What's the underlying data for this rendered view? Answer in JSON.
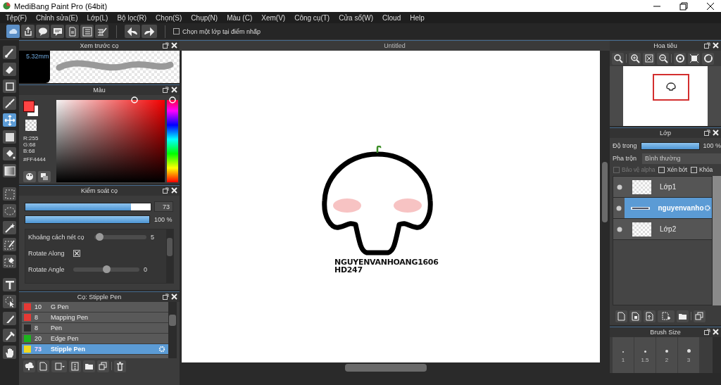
{
  "window": {
    "title": "MediBang Paint Pro (64bit)"
  },
  "menu": [
    "Tệp(F)",
    "Chỉnh sửa(E)",
    "Lớp(L)",
    "Bộ lọc(R)",
    "Chọn(S)",
    "Chụp(N)",
    "Màu (C)",
    "Xem(V)",
    "Công cụ(T)",
    "Cửa sổ(W)",
    "Cloud",
    "Help"
  ],
  "toolbar": {
    "option": {
      "label": "Chọn một lớp tại điểm nhấp",
      "checked": false
    }
  },
  "tools": [
    {
      "kind": "brush",
      "selected": false
    },
    {
      "kind": "eraser",
      "selected": false
    },
    {
      "kind": "dot",
      "selected": false
    },
    {
      "kind": "curve",
      "selected": false
    },
    {
      "kind": "move",
      "selected": true
    },
    {
      "kind": "fill",
      "selected": false
    },
    {
      "kind": "bucket",
      "selected": false
    },
    {
      "kind": "gradient",
      "selected": false
    },
    {
      "kind": "select",
      "selected": false
    },
    {
      "kind": "lasso",
      "selected": false
    },
    {
      "kind": "wand",
      "selected": false
    },
    {
      "kind": "selpen",
      "selected": false
    },
    {
      "kind": "selerase",
      "selected": false
    },
    {
      "kind": "text",
      "selected": false
    },
    {
      "kind": "operation",
      "selected": false
    },
    {
      "kind": "divide",
      "selected": false
    },
    {
      "kind": "dropper",
      "selected": false
    },
    {
      "kind": "hand",
      "selected": false
    }
  ],
  "brush_preview": {
    "title": "Xem trước cọ",
    "size": "5.32mm"
  },
  "color": {
    "title": "Màu",
    "r": "R:255",
    "g": "G:68",
    "b": "B:68",
    "hex": "#FF4444"
  },
  "brush_control": {
    "title": "Kiểm soát cọ",
    "size": {
      "level": 0.84,
      "reading": "73"
    },
    "opacity": {
      "level": 1,
      "reading": "100 %"
    },
    "rows": [
      {
        "kind": "slider",
        "label": "Khoảng cách nét cọ",
        "level": 0.03,
        "reading": "5"
      },
      {
        "kind": "checkbox",
        "label": "Rotate Along",
        "checked": true
      },
      {
        "kind": "slider",
        "label": "Rotate Angle",
        "level": 0.5,
        "reading": "0"
      }
    ]
  },
  "brushes": {
    "title": "Cọ: Stipple Pen",
    "items": [
      {
        "size": "10",
        "name": "G Pen",
        "color": "#e53935",
        "selected": false
      },
      {
        "size": "8",
        "name": "Mapping Pen",
        "color": "#e53935",
        "selected": false
      },
      {
        "size": "8",
        "name": "Pen",
        "color": "#2a2a2a",
        "selected": false
      },
      {
        "size": "20",
        "name": "Edge Pen",
        "color": "#1db31d",
        "selected": false
      },
      {
        "size": "73",
        "name": "Stipple Pen",
        "color": "#f0d820",
        "selected": true
      }
    ]
  },
  "canvas": {
    "tab": "Untitled",
    "lines": [
      "NGUYENVANHOANG1606",
      "HD247"
    ]
  },
  "navigator": {
    "title": "Hoa tiêu"
  },
  "layers": {
    "title": "Lớp",
    "opacity_label": "Độ trong",
    "opacity": {
      "level": 1,
      "reading": "100 %"
    },
    "blend_label": "Pha trộn",
    "blend": "Bình thường",
    "options": [
      {
        "label": "Bảo vệ alpha",
        "checked": false,
        "disabled": true
      },
      {
        "label": "Xén bớt",
        "checked": false,
        "disabled": false
      },
      {
        "label": "Khóa",
        "checked": false,
        "disabled": false
      }
    ],
    "items": [
      {
        "name": "Lớp1",
        "kind": "raster",
        "selected": false
      },
      {
        "name": "nguyenvanho",
        "kind": "text",
        "selected": true
      },
      {
        "name": "Lớp2",
        "kind": "raster",
        "selected": false
      }
    ]
  },
  "brush_size": {
    "title": "Brush Size",
    "items": [
      "1",
      "1.5",
      "2",
      "3"
    ]
  }
}
